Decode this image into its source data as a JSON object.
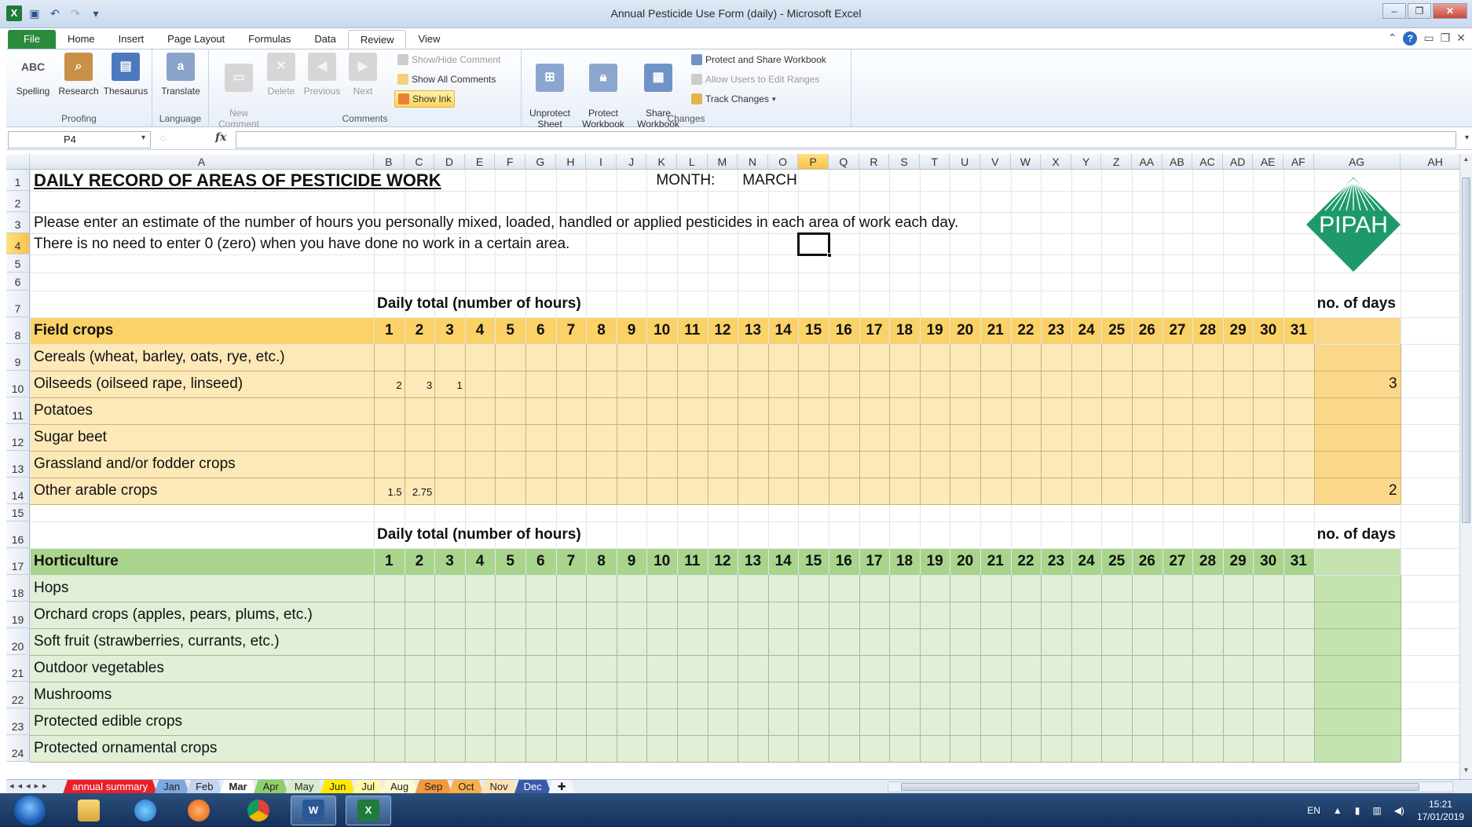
{
  "window": {
    "title": "Annual Pesticide Use Form (daily) - Microsoft Excel"
  },
  "ribbon": {
    "tabs": [
      "File",
      "Home",
      "Insert",
      "Page Layout",
      "Formulas",
      "Data",
      "Review",
      "View"
    ],
    "active_tab": "Review",
    "groups": {
      "proofing": {
        "label": "Proofing",
        "spelling": "Spelling",
        "spelling_icon_text": "ABC",
        "research": "Research",
        "thesaurus": "Thesaurus"
      },
      "language": {
        "label": "Language",
        "translate": "Translate"
      },
      "comments": {
        "label": "Comments",
        "new_comment": "New\nComment",
        "delete": "Delete",
        "previous": "Previous",
        "next": "Next",
        "show_hide": "Show/Hide Comment",
        "show_all": "Show All Comments",
        "show_ink": "Show Ink"
      },
      "changes": {
        "label": "Changes",
        "unprotect_sheet": "Unprotect\nSheet",
        "protect_workbook": "Protect\nWorkbook",
        "share_workbook": "Share\nWorkbook",
        "protect_share": "Protect and Share Workbook",
        "allow_users": "Allow Users to Edit Ranges",
        "track_changes": "Track Changes"
      }
    }
  },
  "formula_bar": {
    "name_box": "P4",
    "fx": "fx",
    "value": ""
  },
  "columns": [
    "A",
    "B",
    "C",
    "D",
    "E",
    "F",
    "G",
    "H",
    "I",
    "J",
    "K",
    "L",
    "M",
    "N",
    "O",
    "P",
    "Q",
    "R",
    "S",
    "T",
    "U",
    "V",
    "W",
    "X",
    "Y",
    "Z",
    "AA",
    "AB",
    "AC",
    "AD",
    "AE",
    "AF",
    "AG",
    "AH"
  ],
  "selected_cell": {
    "column": "P",
    "row": 4
  },
  "sheet": {
    "title": "DAILY RECORD OF AREAS OF PESTICIDE WORK",
    "month_label": "MONTH:",
    "month_value": "MARCH",
    "instruction_1": "Please enter an estimate of the number of hours you personally mixed, loaded, handled or applied pesticides in each area of work each day.",
    "instruction_2": "There is no need to enter 0 (zero) when you have done no work in a certain area.",
    "logo_text": "PIPAH",
    "daily_total_label": "Daily total (number of hours)",
    "no_days_label": "no. of days",
    "days": [
      "1",
      "2",
      "3",
      "4",
      "5",
      "6",
      "7",
      "8",
      "9",
      "10",
      "11",
      "12",
      "13",
      "14",
      "15",
      "16",
      "17",
      "18",
      "19",
      "20",
      "21",
      "22",
      "23",
      "24",
      "25",
      "26",
      "27",
      "28",
      "29",
      "30",
      "31"
    ],
    "field_crops": {
      "header": "Field crops",
      "rows": [
        {
          "label": "Cereals (wheat, barley, oats, rye, etc.)",
          "values": [
            "",
            "",
            ""
          ],
          "total": ""
        },
        {
          "label": "Oilseeds (oilseed rape, linseed)",
          "values": [
            "2",
            "3",
            "1"
          ],
          "total": "3"
        },
        {
          "label": "Potatoes",
          "values": [
            "",
            "",
            ""
          ],
          "total": ""
        },
        {
          "label": "Sugar beet",
          "values": [
            "",
            "",
            ""
          ],
          "total": ""
        },
        {
          "label": "Grassland and/or fodder crops",
          "values": [
            "",
            "",
            ""
          ],
          "total": ""
        },
        {
          "label": "Other arable crops",
          "values": [
            "1.5",
            "2.75",
            ""
          ],
          "total": "2"
        }
      ]
    },
    "horticulture": {
      "header": "Horticulture",
      "rows": [
        {
          "label": "Hops"
        },
        {
          "label": "Orchard crops (apples, pears, plums, etc.)"
        },
        {
          "label": "Soft fruit (strawberries, currants, etc.)"
        },
        {
          "label": "Outdoor vegetables"
        },
        {
          "label": "Mushrooms"
        },
        {
          "label": "Protected edible crops"
        },
        {
          "label": "Protected ornamental crops"
        }
      ]
    }
  },
  "sheet_tabs": [
    {
      "label": "annual summary",
      "color": "#e8202a"
    },
    {
      "label": "Jan",
      "color": "#7ea7de"
    },
    {
      "label": "Feb",
      "color": "#c4d5ee"
    },
    {
      "label": "Mar",
      "color": "#ffffff"
    },
    {
      "label": "Apr",
      "color": "#8fcf6a"
    },
    {
      "label": "May",
      "color": "#d8eccb"
    },
    {
      "label": "Jun",
      "color": "#ffe900"
    },
    {
      "label": "Jul",
      "color": "#fff6a8"
    },
    {
      "label": "Aug",
      "color": "#fff9d0"
    },
    {
      "label": "Sep",
      "color": "#f29a3a"
    },
    {
      "label": "Oct",
      "color": "#f7b04a"
    },
    {
      "label": "Nov",
      "color": "#fde2b5"
    },
    {
      "label": "Dec",
      "color": "#3a59a8"
    }
  ],
  "active_sheet": "Mar",
  "taskbar": {
    "language": "EN",
    "time": "15:21",
    "date": "17/01/2019"
  },
  "colors": {
    "field_header": "#fbd268",
    "field_body": "#fde9b8",
    "field_total": "#fbd78a",
    "hort_header": "#a8d48c",
    "hort_body": "#e1efd6",
    "hort_total": "#c4e3ae",
    "logo": "#1e9a6a"
  }
}
